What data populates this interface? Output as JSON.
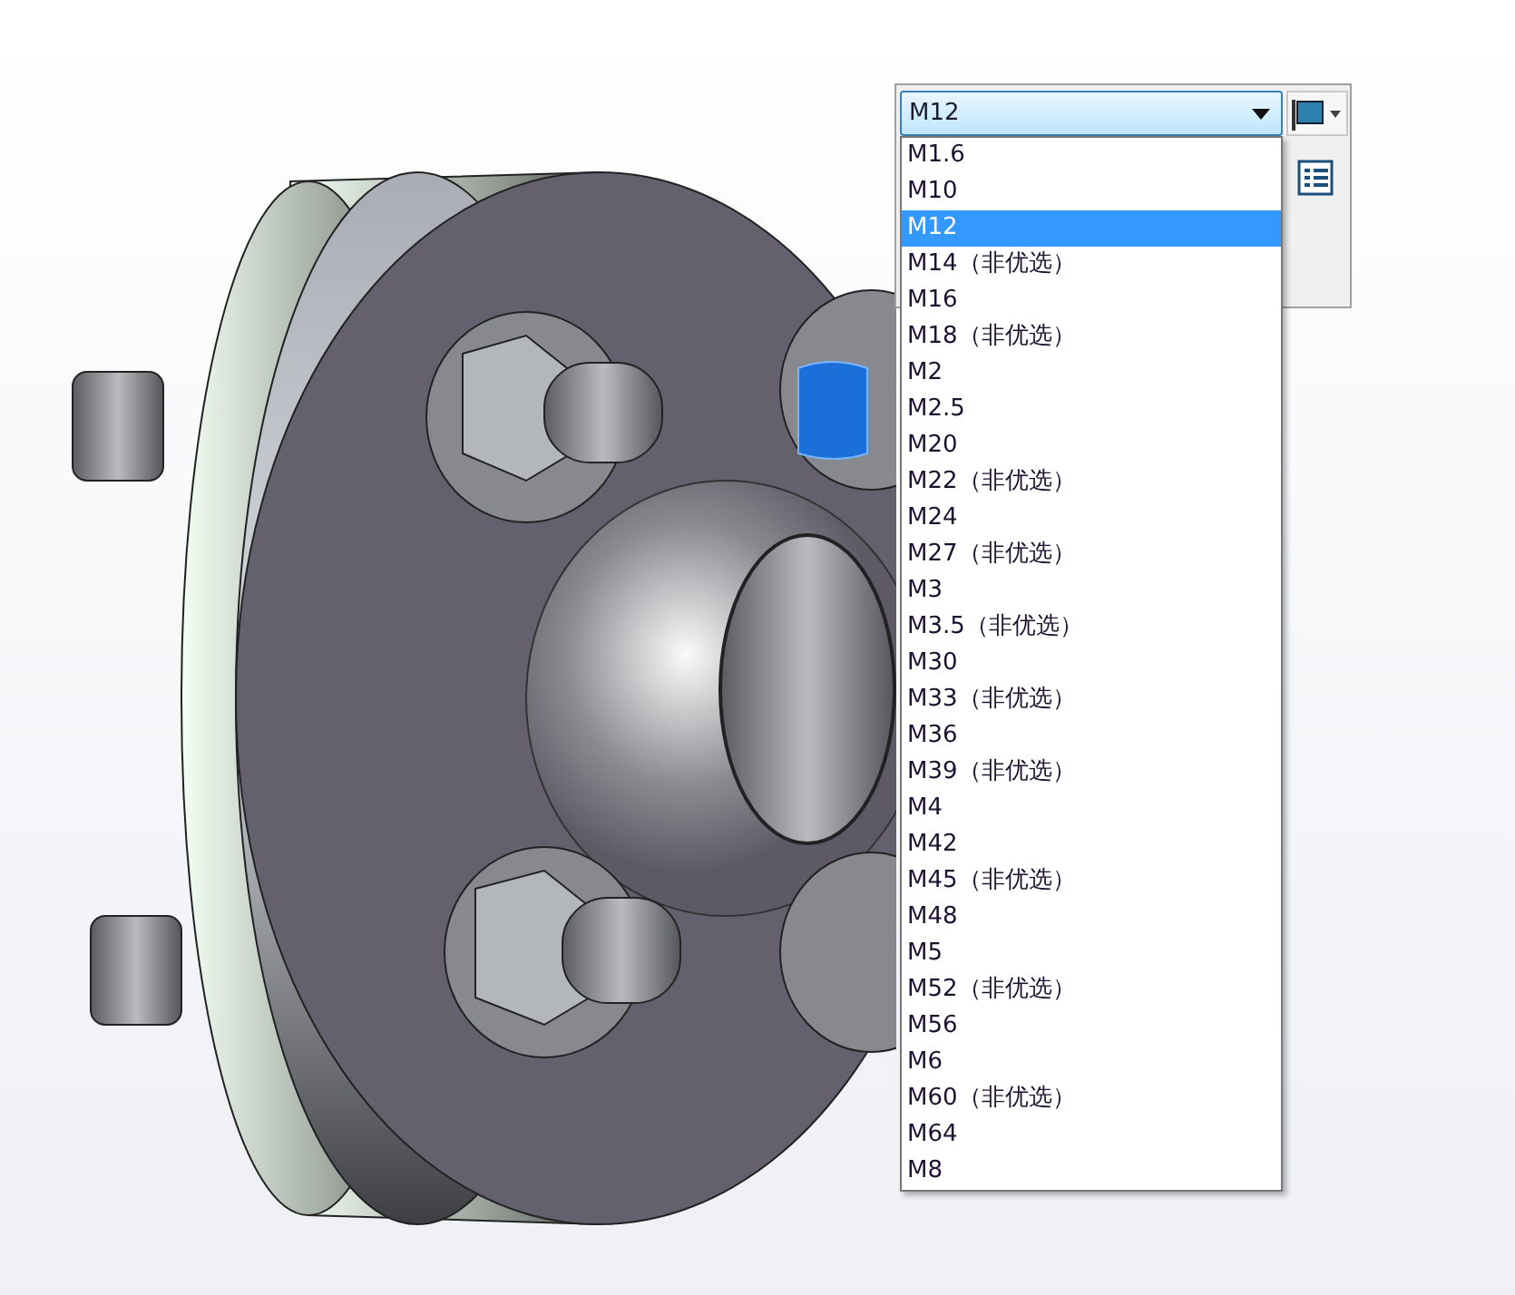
{
  "size_combo": {
    "value": "M12",
    "expanded": true
  },
  "size_options": [
    {
      "label": "M1.6",
      "selected": false
    },
    {
      "label": "M10",
      "selected": false
    },
    {
      "label": "M12",
      "selected": true
    },
    {
      "label": "M14（非优选）",
      "selected": false
    },
    {
      "label": "M16",
      "selected": false
    },
    {
      "label": "M18（非优选）",
      "selected": false
    },
    {
      "label": "M2",
      "selected": false
    },
    {
      "label": "M2.5",
      "selected": false
    },
    {
      "label": "M20",
      "selected": false
    },
    {
      "label": "M22（非优选）",
      "selected": false
    },
    {
      "label": "M24",
      "selected": false
    },
    {
      "label": "M27（非优选）",
      "selected": false
    },
    {
      "label": "M3",
      "selected": false
    },
    {
      "label": "M3.5（非优选）",
      "selected": false
    },
    {
      "label": "M30",
      "selected": false
    },
    {
      "label": "M33（非优选）",
      "selected": false
    },
    {
      "label": "M36",
      "selected": false
    },
    {
      "label": "M39（非优选）",
      "selected": false
    },
    {
      "label": "M4",
      "selected": false
    },
    {
      "label": "M42",
      "selected": false
    },
    {
      "label": "M45（非优选）",
      "selected": false
    },
    {
      "label": "M48",
      "selected": false
    },
    {
      "label": "M5",
      "selected": false
    },
    {
      "label": "M52（非优选）",
      "selected": false
    },
    {
      "label": "M56",
      "selected": false
    },
    {
      "label": "M6",
      "selected": false
    },
    {
      "label": "M60（非优选）",
      "selected": false
    },
    {
      "label": "M64",
      "selected": false
    },
    {
      "label": "M8",
      "selected": false
    }
  ]
}
